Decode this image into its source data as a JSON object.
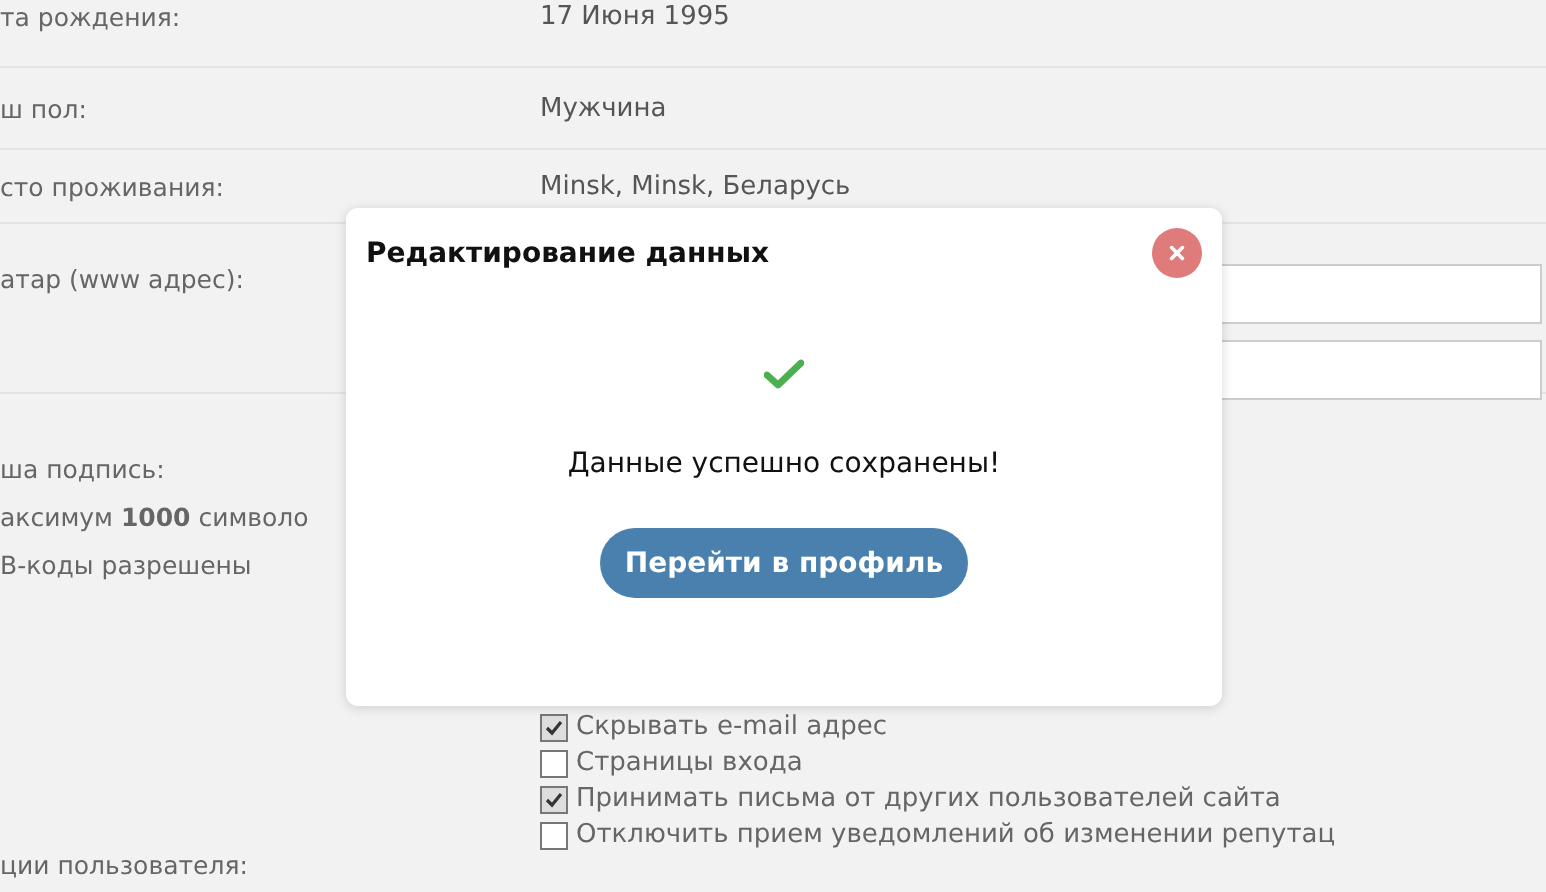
{
  "profile_form": {
    "rows": [
      {
        "kind": "text",
        "label": "та рождения:",
        "value": "17 Июня 1995"
      },
      {
        "kind": "text",
        "label": "ш пол:",
        "value": "Мужчина"
      },
      {
        "kind": "text",
        "label": "сто проживания:",
        "value": "Minsk, Minsk, Беларусь"
      },
      {
        "kind": "fields",
        "label": "атар (www адрес):"
      },
      {
        "kind": "signature",
        "label": "ша подпись:",
        "notes": [
          "аксимум **1000** символо",
          "В-коды разрешены"
        ]
      },
      {
        "kind": "options",
        "label": "ции пользователя:",
        "options": [
          {
            "label": "Скрывать e-mail адрес",
            "checked": true
          },
          {
            "label": "Страницы входа",
            "checked": false
          },
          {
            "label": "Принимать письма от других пользователей сайта",
            "checked": true
          },
          {
            "label": "Отключить прием уведомлений об изменении репутац",
            "checked": false
          }
        ]
      }
    ]
  },
  "dialog": {
    "title": "Редактирование данных",
    "message": "Данные успешно сохранены!",
    "button": "Перейти в профиль"
  }
}
